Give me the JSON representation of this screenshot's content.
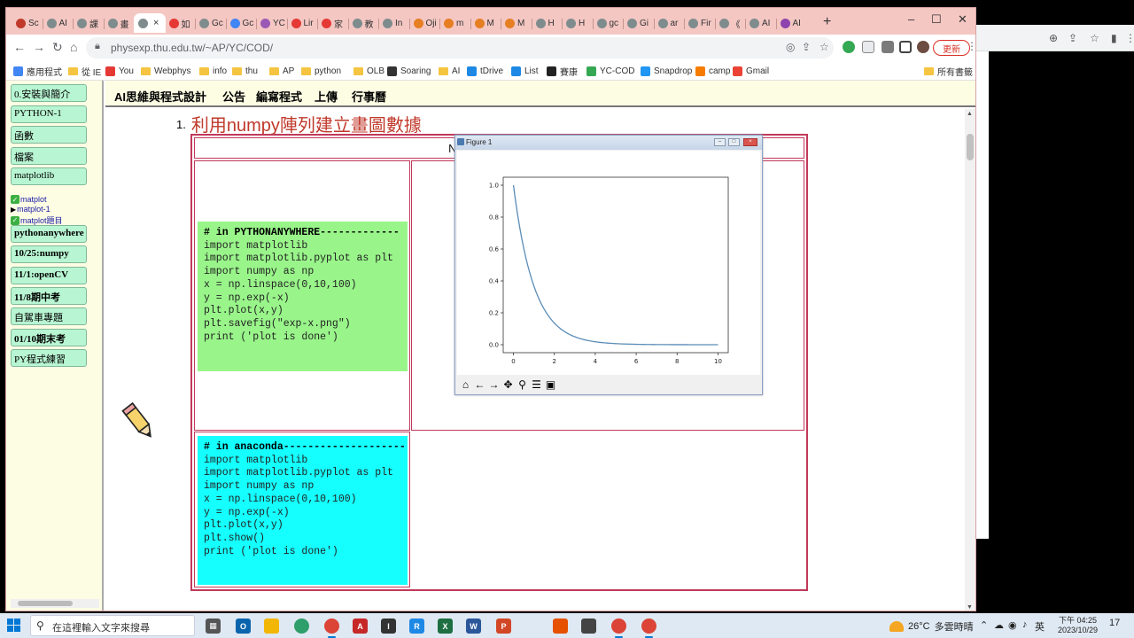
{
  "browser": {
    "tabs": [
      {
        "label": "Sc",
        "color": "#c0392b"
      },
      {
        "label": "AI",
        "color": "#7f8c8d"
      },
      {
        "label": "課",
        "color": "#7f8c8d"
      },
      {
        "label": "畫",
        "color": "#7f8c8d"
      },
      {
        "label": "",
        "color": "#7f8c8d"
      },
      {
        "label": "如",
        "color": "#e53935"
      },
      {
        "label": "Gc",
        "color": "#7f8c8d"
      },
      {
        "label": "Gc",
        "color": "#4285f4"
      },
      {
        "label": "YC",
        "color": "#9b59b6"
      },
      {
        "label": "Lir",
        "color": "#e53935"
      },
      {
        "label": "家",
        "color": "#e53935"
      },
      {
        "label": "教",
        "color": "#7f8c8d"
      },
      {
        "label": "In",
        "color": "#7f8c8d"
      },
      {
        "label": "Oji",
        "color": "#e67e22"
      },
      {
        "label": "m",
        "color": "#e67e22"
      },
      {
        "label": "M",
        "color": "#e67e22"
      },
      {
        "label": "M",
        "color": "#e67e22"
      },
      {
        "label": "H",
        "color": "#7f8c8d"
      },
      {
        "label": "H",
        "color": "#7f8c8d"
      },
      {
        "label": "gc",
        "color": "#7f8c8d"
      },
      {
        "label": "Gi",
        "color": "#7f8c8d"
      },
      {
        "label": "ar",
        "color": "#7f8c8d"
      },
      {
        "label": "Fir",
        "color": "#7f8c8d"
      },
      {
        "label": "《",
        "color": "#7f8c8d"
      },
      {
        "label": "AI",
        "color": "#7f8c8d"
      },
      {
        "label": "AI",
        "color": "#8e44ad"
      }
    ],
    "url": "physexp.thu.edu.tw/~AP/YC/COD/",
    "update_label": "更新",
    "bookmarks": [
      {
        "label": "應用程式",
        "kind": "apps"
      },
      {
        "label": "從 IE",
        "kind": "folder"
      },
      {
        "label": "You",
        "kind": "youtube"
      },
      {
        "label": "Webphys",
        "kind": "folder"
      },
      {
        "label": "info",
        "kind": "folder"
      },
      {
        "label": "thu",
        "kind": "folder"
      },
      {
        "label": "AP",
        "kind": "folder"
      },
      {
        "label": "python",
        "kind": "folder"
      },
      {
        "label": "OLB",
        "kind": "folder"
      },
      {
        "label": "Soaring",
        "kind": "sr"
      },
      {
        "label": "AI",
        "kind": "folder"
      },
      {
        "label": "tDrive",
        "kind": "cloud"
      },
      {
        "label": "List",
        "kind": "doc"
      },
      {
        "label": "賽康",
        "kind": "dark"
      },
      {
        "label": "YC-COD",
        "kind": "drive"
      },
      {
        "label": "Snapdrop",
        "kind": "snap"
      },
      {
        "label": "camp",
        "kind": "camp"
      },
      {
        "label": "Gmail",
        "kind": "gmail"
      }
    ],
    "all_bookmarks": "所有書籤"
  },
  "sidebar": {
    "items": [
      {
        "label": "0.安裝與簡介",
        "bold": false
      },
      {
        "label": "PYTHON-1",
        "bold": false
      },
      {
        "label": "函數",
        "bold": false
      },
      {
        "label": "檔案",
        "bold": false
      },
      {
        "label": "matplotlib",
        "bold": false
      }
    ],
    "sublinks": [
      {
        "label": "matplot",
        "marker": "check"
      },
      {
        "label": "matplot-1",
        "marker": "triangle"
      },
      {
        "label": "matplot題目",
        "marker": "check"
      }
    ],
    "items2": [
      {
        "label": "pythonanywhere",
        "bold": true
      },
      {
        "label": "10/25:numpy",
        "bold": true
      },
      {
        "label": "11/1:openCV",
        "bold": true
      },
      {
        "label": "11/8期中考",
        "bold": true
      },
      {
        "label": "自駕車專題",
        "bold": false
      },
      {
        "label": "01/10期末考",
        "bold": true
      },
      {
        "label": "PY程式練習",
        "bold": false
      }
    ]
  },
  "topmenu": {
    "items": [
      "AI思維與程式設計",
      "公告",
      "編寫程式",
      "上傳",
      "行事曆"
    ]
  },
  "content": {
    "heading_num": "1.",
    "heading_a": "利用",
    "heading_b": "numpy",
    "heading_c": "陣列建立畫圖數據",
    "table_title": "NUM-matplot-sin.py",
    "code1": {
      "comment": "# in PYTHONANYWHERE-------------",
      "lines": "import matplotlib\nimport matplotlib.pyplot as plt\nimport numpy as np\nx = np.linspace(0,10,100)\ny = np.exp(-x)\nplt.plot(x,y)\nplt.savefig(\"exp-x.png\")\nprint ('plot is done')",
      "bg": "#99f58a"
    },
    "code2": {
      "comment": "# in anaconda--------------------",
      "lines": "import matplotlib\nimport matplotlib.pyplot as plt\nimport numpy as np\nx = np.linspace(0,10,100)\ny = np.exp(-x)\nplt.plot(x,y)\nplt.show()\nprint ('plot is done')",
      "bg": "#16ffff"
    }
  },
  "figure": {
    "title": "Figure 1",
    "toolbar_icons": [
      "home-icon",
      "back-icon",
      "forward-icon",
      "pan-icon",
      "zoom-icon",
      "configure-icon",
      "save-icon"
    ]
  },
  "chart_data": {
    "type": "line",
    "title": "",
    "xlabel": "",
    "ylabel": "",
    "xlim": [
      -0.5,
      10.5
    ],
    "ylim": [
      -0.05,
      1.05
    ],
    "xticks": [
      0,
      2,
      4,
      6,
      8,
      10
    ],
    "yticks": [
      0.0,
      0.2,
      0.4,
      0.6,
      0.8,
      1.0
    ],
    "ytick_labels": [
      "0.0",
      "0.2",
      "0.4",
      "0.6",
      "0.8",
      "1.0"
    ],
    "x": [
      0,
      0.5,
      1,
      1.5,
      2,
      2.5,
      3,
      3.5,
      4,
      4.5,
      5,
      6,
      7,
      8,
      9,
      10
    ],
    "y": [
      1.0,
      0.607,
      0.368,
      0.223,
      0.135,
      0.082,
      0.05,
      0.03,
      0.018,
      0.011,
      0.007,
      0.002,
      0.001,
      0.0,
      0.0,
      0.0
    ],
    "line_color": "#5b8db8",
    "grid": false
  },
  "taskbar": {
    "search_placeholder": "在這裡輸入文字來搜尋",
    "weather_temp": "26°C",
    "weather_desc": "多雲時晴",
    "ime": "英",
    "time": "下午 04:25",
    "date": "2023/10/29",
    "notif_count": "17"
  }
}
